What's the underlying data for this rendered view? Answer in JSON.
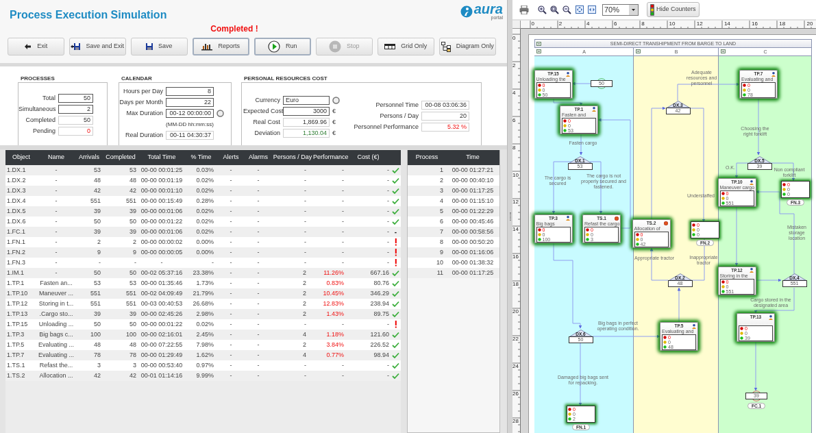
{
  "title": "Process Execution Simulation",
  "logo": {
    "text": "aura",
    "subtext": "portal"
  },
  "status_message": "Completed !",
  "toolbar": [
    {
      "label": "Exit",
      "emphasized": false,
      "disabled": false
    },
    {
      "label": "Save and Exit",
      "emphasized": false,
      "disabled": false
    },
    {
      "label": "Save",
      "emphasized": false,
      "disabled": false
    },
    {
      "label": "Reports",
      "emphasized": true,
      "disabled": false
    },
    {
      "label": "Run",
      "emphasized": true,
      "disabled": false
    },
    {
      "label": "Stop",
      "emphasized": false,
      "disabled": true
    },
    {
      "label": "Grid Only",
      "emphasized": false,
      "disabled": false
    },
    {
      "label": "Diagram Only",
      "emphasized": false,
      "disabled": false
    }
  ],
  "processes": {
    "title": "PROCESSES",
    "fields": [
      {
        "label": "Total",
        "value": "50",
        "editable": true,
        "alert": false
      },
      {
        "label": "Simultaneous",
        "value": "2",
        "editable": true,
        "alert": false
      },
      {
        "label": "Completed",
        "value": "50",
        "editable": false,
        "alert": false
      },
      {
        "label": "Pending",
        "value": "0",
        "editable": false,
        "alert": true
      }
    ]
  },
  "calendar": {
    "title": "CALENDAR",
    "fields": [
      {
        "label": "Hours per Day",
        "value": "8",
        "editable": true,
        "kind": "text"
      },
      {
        "label": "Days per Month",
        "value": "22",
        "editable": true,
        "kind": "text"
      },
      {
        "label": "Max Duration",
        "value": "00-12 00:00:00",
        "editable": true,
        "kind": "picker",
        "note": "(MM-DD hh:mm:ss)"
      },
      {
        "label": "Real Duration",
        "value": "00-11 04:30:37",
        "editable": false,
        "kind": "text"
      }
    ]
  },
  "cost": {
    "title": "PERSONAL RESOURCES COST",
    "left_fields": [
      {
        "label": "Currency",
        "value": "Euro",
        "editable": true,
        "kind": "select",
        "good": false
      },
      {
        "label": "Expected Cost",
        "value": "3000",
        "editable": true,
        "kind": "text",
        "unit": "€",
        "good": false
      },
      {
        "label": "Real Cost",
        "value": "1,869.96",
        "editable": false,
        "kind": "text",
        "unit": "€",
        "good": false
      },
      {
        "label": "Deviation",
        "value": "1,130.04",
        "editable": false,
        "kind": "text",
        "unit": "€",
        "good": true
      }
    ],
    "right_fields": [
      {
        "label": "Personnel Time",
        "value": "00-08 03:06:36",
        "alert": false
      },
      {
        "label": "Persons / Day",
        "value": "20",
        "alert": false
      },
      {
        "label": "Personnel Performance",
        "value": "5.32 %",
        "alert": true
      }
    ]
  },
  "table": {
    "columns": [
      "Object",
      "Name",
      "Arrivals",
      "Completed",
      "Total Time",
      "% Time",
      "Alerts",
      "Alarms",
      "Persons / Day",
      "Performance",
      "Cost (€)"
    ],
    "rows": [
      {
        "cells": [
          "1.DX.1",
          "-",
          "53",
          "53",
          "00-00 00:01:25",
          "0.03%",
          "-",
          "-",
          "-",
          "-",
          "-"
        ],
        "performance_alert": false,
        "kind": "check"
      },
      {
        "cells": [
          "1.DX.2",
          "-",
          "48",
          "48",
          "00-00 00:01:19",
          "0.02%",
          "-",
          "-",
          "-",
          "-",
          "-"
        ],
        "performance_alert": false,
        "kind": "check"
      },
      {
        "cells": [
          "1.DX.3",
          "-",
          "42",
          "42",
          "00-00 00:01:10",
          "0.02%",
          "-",
          "-",
          "-",
          "-",
          "-"
        ],
        "performance_alert": false,
        "kind": "check"
      },
      {
        "cells": [
          "1.DX.4",
          "-",
          "551",
          "551",
          "00-00 00:15:49",
          "0.28%",
          "-",
          "-",
          "-",
          "-",
          "-"
        ],
        "performance_alert": false,
        "kind": "check"
      },
      {
        "cells": [
          "1.DX.5",
          "-",
          "39",
          "39",
          "00-00 00:01:06",
          "0.02%",
          "-",
          "-",
          "-",
          "-",
          "-"
        ],
        "performance_alert": false,
        "kind": "check"
      },
      {
        "cells": [
          "1.DX.6",
          "-",
          "50",
          "50",
          "00-00 00:01:22",
          "0.02%",
          "-",
          "-",
          "-",
          "-",
          "-"
        ],
        "performance_alert": false,
        "kind": "check"
      },
      {
        "cells": [
          "1.FC.1",
          "-",
          "39",
          "39",
          "00-00 00:01:06",
          "0.02%",
          "-",
          "-",
          "-",
          "-",
          "-"
        ],
        "performance_alert": false,
        "kind": "text",
        "status_text": "-"
      },
      {
        "cells": [
          "1.FN.1",
          "-",
          "2",
          "2",
          "00-00 00:00:02",
          "0.00%",
          "-",
          "-",
          "-",
          "-",
          "-"
        ],
        "performance_alert": false,
        "kind": "warning"
      },
      {
        "cells": [
          "1.FN.2",
          "-",
          "9",
          "9",
          "00-00 00:00:05",
          "0.00%",
          "-",
          "-",
          "-",
          "-",
          "-"
        ],
        "performance_alert": false,
        "kind": "warning"
      },
      {
        "cells": [
          "1.FN.3",
          "-",
          "-",
          "-",
          "-",
          "-",
          "-",
          "-",
          "-",
          "-",
          "-"
        ],
        "performance_alert": false,
        "kind": "warning"
      },
      {
        "cells": [
          "1.IM.1",
          "-",
          "50",
          "50",
          "00-02 05:37:16",
          "23.38%",
          "-",
          "-",
          "2",
          "11.26%",
          "667.16"
        ],
        "performance_alert": true,
        "kind": "check"
      },
      {
        "cells": [
          "1.TP.1",
          "Fasten an...",
          "53",
          "53",
          "00-00 01:35:46",
          "1.73%",
          "-",
          "-",
          "2",
          "0.83%",
          "80.76"
        ],
        "performance_alert": true,
        "kind": "check"
      },
      {
        "cells": [
          "1.TP.10",
          "Maneuver ...",
          "551",
          "551",
          "00-02 04:09:49",
          "21.79%",
          "-",
          "-",
          "2",
          "10.45%",
          "346.29"
        ],
        "performance_alert": true,
        "kind": "check"
      },
      {
        "cells": [
          "1.TP.12",
          "Storing in t...",
          "551",
          "551",
          "00-03 00:40:53",
          "26.68%",
          "-",
          "-",
          "2",
          "12.83%",
          "238.94"
        ],
        "performance_alert": true,
        "kind": "check"
      },
      {
        "cells": [
          "1.TP.13",
          ".Cargo sto...",
          "39",
          "39",
          "00-00 02:45:26",
          "2.98%",
          "-",
          "-",
          "2",
          "1.43%",
          "89.75"
        ],
        "performance_alert": true,
        "kind": "check"
      },
      {
        "cells": [
          "1.TP.15",
          "Unloading ...",
          "50",
          "50",
          "00-00 00:01:22",
          "0.02%",
          "-",
          "-",
          "-",
          "-",
          "-"
        ],
        "performance_alert": false,
        "kind": "warning"
      },
      {
        "cells": [
          "1.TP.3",
          "Big bags c...",
          "100",
          "100",
          "00-00 02:16:01",
          "2.45%",
          "-",
          "-",
          "4",
          "1.18%",
          "121.60"
        ],
        "performance_alert": true,
        "kind": "check"
      },
      {
        "cells": [
          "1.TP.5",
          "Evaluating ...",
          "48",
          "48",
          "00-00 07:22:55",
          "7.98%",
          "-",
          "-",
          "2",
          "3.84%",
          "226.52"
        ],
        "performance_alert": true,
        "kind": "check"
      },
      {
        "cells": [
          "1.TP.7",
          "Evaluating ...",
          "78",
          "78",
          "00-00 01:29:49",
          "1.62%",
          "-",
          "-",
          "4",
          "0.77%",
          "98.94"
        ],
        "performance_alert": true,
        "kind": "check"
      },
      {
        "cells": [
          "1.TS.1",
          "Refast the...",
          "3",
          "3",
          "00-00 00:53:40",
          "0.97%",
          "-",
          "-",
          "-",
          "-",
          "-"
        ],
        "performance_alert": false,
        "kind": "check"
      },
      {
        "cells": [
          "1.TS.2",
          "Allocation ...",
          "42",
          "42",
          "00-01 01:14:16",
          "9.99%",
          "-",
          "-",
          "-",
          "-",
          "-"
        ],
        "performance_alert": false,
        "kind": "check"
      }
    ]
  },
  "process_table": {
    "columns": [
      "Process",
      "Time"
    ],
    "rows": [
      [
        "1",
        "00-00 01:27:21"
      ],
      [
        "2",
        "00-00 00:40:10"
      ],
      [
        "3",
        "00-00 01:17:25"
      ],
      [
        "4",
        "00-00 01:15:10"
      ],
      [
        "5",
        "00-00 01:22:29"
      ],
      [
        "6",
        "00-00 00:45:46"
      ],
      [
        "7",
        "00-00 00:58:56"
      ],
      [
        "8",
        "00-00 00:50:20"
      ],
      [
        "9",
        "00-00 01:16:06"
      ],
      [
        "10",
        "00-00 01:38:32"
      ],
      [
        "11",
        "00-00 01:17:25"
      ]
    ]
  },
  "diagram": {
    "zoom": "70%",
    "hide_counters": "Hide Counters",
    "rulers": {
      "horizontal": [
        "0",
        "2",
        "4",
        "6",
        "8",
        "10",
        "12",
        "14",
        "16",
        "18",
        "20"
      ],
      "vertical": [
        "0",
        "2",
        "4",
        "6",
        "8",
        "10",
        "12",
        "14",
        "16",
        "18",
        "20",
        "22",
        "24",
        "26",
        "28"
      ]
    },
    "pool_title": "SEMI-DIRECT TRANSHIPMENT FROM BARGE TO LAND",
    "lanes": [
      {
        "label": "A",
        "color": "#c8fbff"
      },
      {
        "label": "B",
        "color": "#fffdd0"
      },
      {
        "label": "C",
        "color": "#ccffcc"
      }
    ],
    "nodes": [
      {
        "kind": "task",
        "id": "TP.15",
        "label": "Unloading the",
        "counters": [
          {
            "color": "#d50000",
            "value": "0"
          },
          {
            "color": "#e0b800",
            "value": "0"
          },
          {
            "color": "#1fbf1f",
            "value": "50"
          }
        ]
      },
      {
        "kind": "start",
        "count": "50"
      },
      {
        "kind": "task",
        "id": "TP.7",
        "label": "Evaluating and",
        "counters": [
          {
            "color": "#d50000",
            "value": "0"
          },
          {
            "color": "#e0b800",
            "value": "0"
          },
          {
            "color": "#1fbf1f",
            "value": "78"
          }
        ]
      },
      {
        "kind": "task",
        "id": "TP.1",
        "label": "Fasten and",
        "counters": [
          {
            "color": "#d50000",
            "value": "0"
          },
          {
            "color": "#e0b800",
            "value": "0"
          },
          {
            "color": "#1fbf1f",
            "value": "53"
          }
        ]
      },
      {
        "kind": "decision",
        "id": "DX.3",
        "count": "42"
      },
      {
        "kind": "decision",
        "id": "DX.1",
        "count": "53"
      },
      {
        "kind": "decision",
        "id": "DX.5",
        "count": "39"
      },
      {
        "kind": "task",
        "id": "TP.10",
        "label": "Maneuver cargo",
        "counters": [
          {
            "color": "#d50000",
            "value": "0"
          },
          {
            "color": "#e0b800",
            "value": "0"
          },
          {
            "color": "#1fbf1f",
            "value": "551"
          }
        ]
      },
      {
        "kind": "end",
        "id": "FN.3",
        "counters": [
          {
            "color": "#d50000",
            "value": "0"
          },
          {
            "color": "#e0b800",
            "value": "0"
          },
          {
            "color": "#1fbf1f",
            "value": "0"
          }
        ]
      },
      {
        "kind": "task",
        "id": "TP.3",
        "label": "Big bags",
        "counters": [
          {
            "color": "#d50000",
            "value": "0"
          },
          {
            "color": "#e0b800",
            "value": "0"
          },
          {
            "color": "#1fbf1f",
            "value": "100"
          }
        ]
      },
      {
        "kind": "service",
        "id": "TS.1",
        "label": "Refast the cargo",
        "counters": [
          {
            "color": "#d50000",
            "value": "0"
          },
          {
            "color": "#e0b800",
            "value": "0"
          },
          {
            "color": "#1fbf1f",
            "value": "3"
          }
        ]
      },
      {
        "kind": "service",
        "id": "TS.2",
        "label": "Allocation of",
        "counters": [
          {
            "color": "#d50000",
            "value": "0"
          },
          {
            "color": "#e0b800",
            "value": "0"
          },
          {
            "color": "#1fbf1f",
            "value": "42"
          }
        ]
      },
      {
        "kind": "end",
        "id": "FN.2",
        "counters": [
          {
            "color": "#d50000",
            "value": "0"
          },
          {
            "color": "#e0b800",
            "value": "0"
          },
          {
            "color": "#1fbf1f",
            "value": "0"
          }
        ]
      },
      {
        "kind": "decision",
        "id": "DX.2",
        "count": "48"
      },
      {
        "kind": "task",
        "id": "TP.12",
        "label": "Storing in the",
        "counters": [
          {
            "color": "#d50000",
            "value": "0"
          },
          {
            "color": "#e0b800",
            "value": "0"
          },
          {
            "color": "#1fbf1f",
            "value": "551"
          }
        ]
      },
      {
        "kind": "decision",
        "id": "DX.4",
        "count": "551"
      },
      {
        "kind": "decision",
        "id": "DX.6",
        "count": "50"
      },
      {
        "kind": "task",
        "id": "TP.5",
        "label": "Evaluating and",
        "counters": [
          {
            "color": "#d50000",
            "value": "0"
          },
          {
            "color": "#e0b800",
            "value": "0"
          },
          {
            "color": "#1fbf1f",
            "value": "48"
          }
        ]
      },
      {
        "kind": "task",
        "id": "TP.13",
        "counters": [
          {
            "color": "#d50000",
            "value": "0"
          },
          {
            "color": "#e0b800",
            "value": "0"
          },
          {
            "color": "#1fbf1f",
            "value": "39"
          }
        ]
      },
      {
        "kind": "finish",
        "id": "FC.1",
        "count": "39"
      },
      {
        "kind": "end",
        "id": "FN.1",
        "counters": [
          {
            "color": "#d50000",
            "value": "0"
          },
          {
            "color": "#e0b800",
            "value": "0"
          },
          {
            "color": "#1fbf1f",
            "value": "2"
          }
        ]
      }
    ],
    "edge_labels": [
      "Adequate resources and personnel",
      "Choosing the right forklift",
      "Fasten cargo",
      "The cargo is secured",
      "The cargo is not properly secured and fastened.",
      "O.K.",
      "Non compliant forklift",
      "Understaffed",
      "Mistaken storage location",
      "Appropriate tractor",
      "Inappropriate tractor",
      "Cargo stored in the designated area",
      "Big bags in perfect operating condition.",
      "Damaged big bags sent for repacking."
    ]
  }
}
